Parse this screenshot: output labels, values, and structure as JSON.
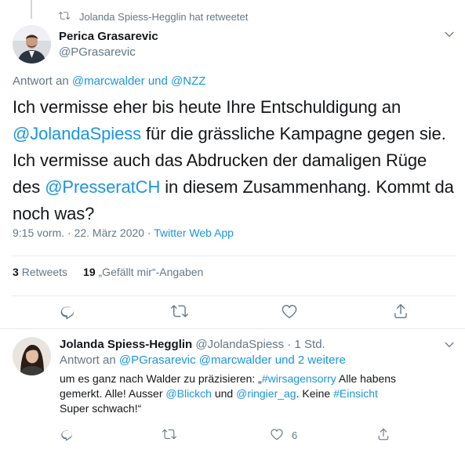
{
  "retweet_header": {
    "text": "Jolanda Spiess-Hegglin hat retweetet",
    "icon": "retweet-icon"
  },
  "tweet": {
    "author_name": "Perica Grasarevic",
    "author_handle": "@PGrasarevic",
    "reply_prefix": "Antwort an",
    "reply_mention_1": "@marcwalder",
    "reply_and": "und",
    "reply_mention_2": "@NZZ",
    "text_1": "Ich vermisse eher bis heute Ihre Entschuldigung an",
    "mention_jolanda": "@JolandaSpiess",
    "text_2": "für die grässliche Kampagne gegen sie. Ich vermisse auch das Abdrucken der damaligen Rüge des",
    "mention_presserat": "@PresseratCH",
    "text_3": "in diesem Zusammenhang. Kommt da noch was?",
    "time": "9:15 vorm. · 22. März 2020 ·",
    "source": "Twitter Web App",
    "retweets_count": "3",
    "retweets_label": "Retweets",
    "likes_count": "19",
    "likes_label": "„Gefällt mir“-Angaben"
  },
  "reply": {
    "author_name": "Jolanda Spiess-Hegglin",
    "author_handle": "@JolandaSpiess",
    "separator": "·",
    "time": "1 Std.",
    "reply_prefix": "Antwort an",
    "reply_mentions": "@PGrasarevic @marcwalder und 2 weitere",
    "text_1": "um es ganz nach Walder zu präzisieren: „",
    "hashtag_1": "#wirsagensorry",
    "text_2": "Alle habens gemerkt. Alle! Ausser",
    "mention_1": "@Blickch",
    "text_3": "und",
    "mention_2": "@ringier_ag",
    "text_4": ". Keine",
    "hashtag_2": "#Einsicht",
    "text_5": "Super schwach!“",
    "like_count": "6"
  },
  "colors": {
    "accent": "#1b95e0",
    "muted": "#657786",
    "text": "#14171a",
    "divider": "#e6ecf0"
  }
}
